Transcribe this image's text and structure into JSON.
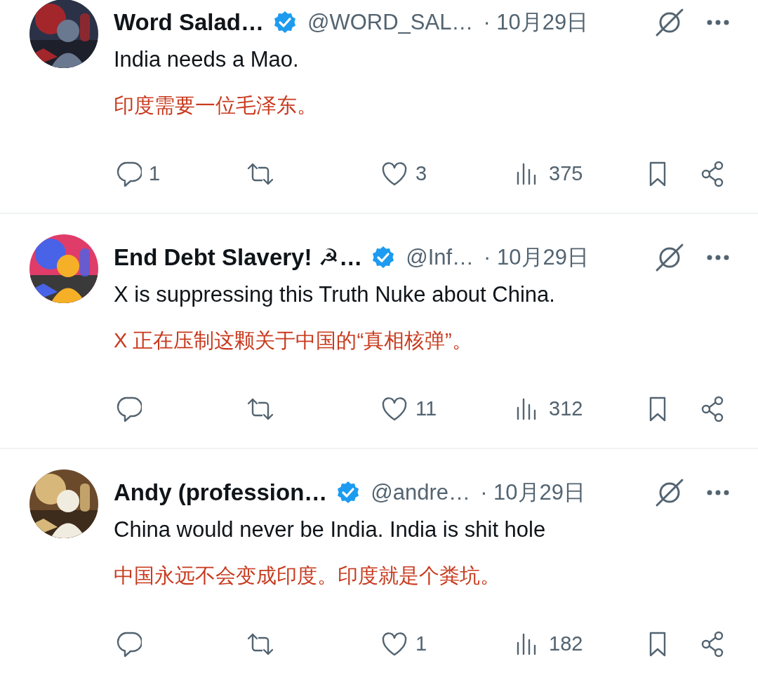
{
  "replies": [
    {
      "name": "Word Salad…",
      "verified": true,
      "handle": "@WORD_SAL…",
      "date": "· 10月29日",
      "text": "India needs a Mao.",
      "translation": "印度需要一位毛泽东。",
      "stats": {
        "replies": "1",
        "likes": "3",
        "views": "375"
      }
    },
    {
      "name": "End Debt Slavery! ☭…",
      "verified": true,
      "handle": "@Inf…",
      "date": "· 10月29日",
      "text": "X is suppressing this Truth Nuke about China.",
      "translation": "X 正在压制这颗关于中国的“真相核弹”。",
      "stats": {
        "likes": "11",
        "views": "312"
      }
    },
    {
      "name": "Andy (profession…",
      "verified": true,
      "handle": "@andre…",
      "date": "· 10月29日",
      "text": "China would never be India. India is shit hole",
      "translation": "中国永远不会变成印度。印度就是个粪坑。",
      "stats": {
        "likes": "1",
        "views": "182"
      }
    }
  ]
}
